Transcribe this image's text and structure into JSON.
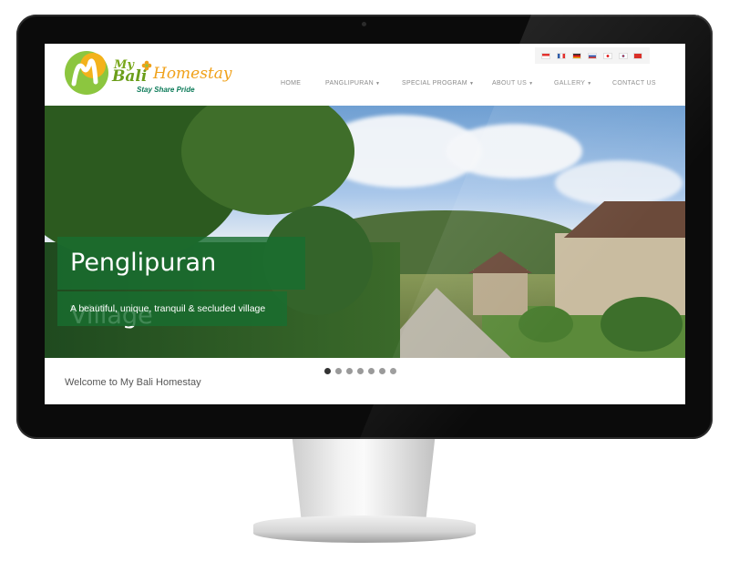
{
  "site": {
    "logo": {
      "brand_my": "My",
      "brand_bali": "Bali",
      "brand_homestay": "Homestay",
      "tagline": "Stay Share Pride",
      "mark_icon": "hibiscus-m-logo-icon"
    },
    "languages": [
      {
        "code": "id",
        "icon": "flag-indonesia-icon",
        "color": "#e0201c"
      },
      {
        "code": "fr",
        "icon": "flag-france-icon",
        "color": "#1d4fa0"
      },
      {
        "code": "de",
        "icon": "flag-germany-icon",
        "color": "#e0a000"
      },
      {
        "code": "ru",
        "icon": "flag-russia-icon",
        "color": "#2b57b0"
      },
      {
        "code": "ja",
        "icon": "flag-japan-icon",
        "color": "#ffffff"
      },
      {
        "code": "ko",
        "icon": "flag-korea-icon",
        "color": "#d4d4d4"
      },
      {
        "code": "zh",
        "icon": "flag-china-icon",
        "color": "#d8231b"
      }
    ],
    "nav": [
      {
        "label": "HOME",
        "dropdown": false
      },
      {
        "label": "PANGLIPURAN",
        "dropdown": true
      },
      {
        "label": "SPECIAL PROGRAM",
        "dropdown": true
      },
      {
        "label": "ABOUT US",
        "dropdown": true
      },
      {
        "label": "GALLERY",
        "dropdown": true
      },
      {
        "label": "CONTACT US",
        "dropdown": false
      }
    ],
    "hero": {
      "title": "Penglipuran Village",
      "subtitle": "A beautiful, unique, tranquil & secluded village",
      "caption_color": "#186e30"
    },
    "slider": {
      "slide_count": 7,
      "active_index": 0
    },
    "welcome_text": "Welcome to My Bali Homestay"
  }
}
